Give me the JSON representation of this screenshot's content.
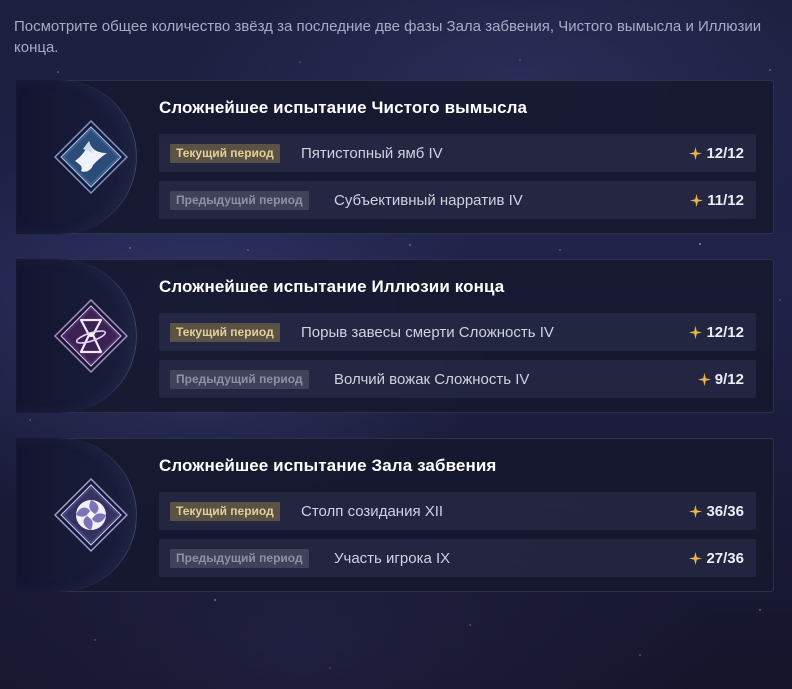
{
  "intro_text": "Посмотрите общее количество звёзд за последние две фазы Зала забвения, Чистого вымысла и Иллюзии конца.",
  "colors": {
    "accent_gold": "#e8b64a",
    "badge_current_bg": "#5a5244",
    "badge_current_text": "#e2cf9a",
    "badge_previous_bg": "#40425a",
    "badge_previous_text": "#8d91a8"
  },
  "cards": [
    {
      "title": "Сложнейшее испытание Чистого вымысла",
      "icon": "bird-emblem-icon",
      "current": {
        "badge": "Текущий период",
        "name": "Пятистопный ямб IV",
        "score": "12/12"
      },
      "previous": {
        "badge": "Предыдущий период",
        "name": "Субъективный нарратив IV",
        "score": "11/12"
      }
    },
    {
      "title": "Сложнейшее испытание Иллюзии конца",
      "icon": "hourglass-emblem-icon",
      "current": {
        "badge": "Текущий период",
        "name": "Порыв завесы смерти Сложность IV",
        "score": "12/12"
      },
      "previous": {
        "badge": "Предыдущий период",
        "name": "Волчий вожак Сложность IV",
        "score": "9/12"
      }
    },
    {
      "title": "Сложнейшее испытание Зала забвения",
      "icon": "vortex-emblem-icon",
      "current": {
        "badge": "Текущий период",
        "name": "Столп созидания XII",
        "score": "36/36"
      },
      "previous": {
        "badge": "Предыдущий период",
        "name": "Участь игрока IX",
        "score": "27/36"
      }
    }
  ]
}
